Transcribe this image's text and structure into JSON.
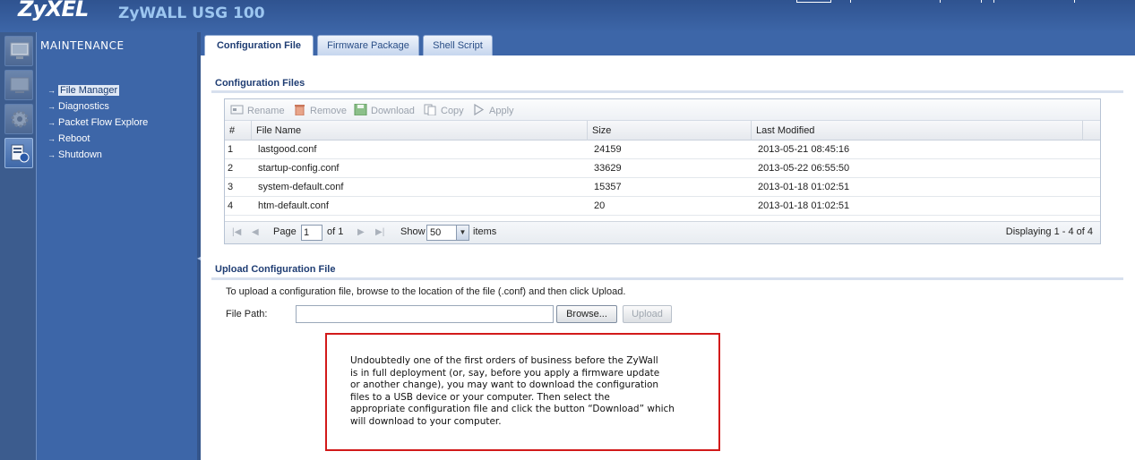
{
  "header": {
    "brand": "ZyXEL",
    "product": "ZyWALL USG 100"
  },
  "menu": {
    "title": "MAINTENANCE",
    "items": [
      {
        "label": "File Manager",
        "selected": true
      },
      {
        "label": "Diagnostics",
        "selected": false
      },
      {
        "label": "Packet Flow Explore",
        "selected": false
      },
      {
        "label": "Reboot",
        "selected": false
      },
      {
        "label": "Shutdown",
        "selected": false
      }
    ]
  },
  "tabs": [
    {
      "label": "Configuration File",
      "active": true
    },
    {
      "label": "Firmware Package",
      "active": false
    },
    {
      "label": "Shell Script",
      "active": false
    }
  ],
  "config_files": {
    "title": "Configuration Files",
    "toolbar": {
      "rename": "Rename",
      "remove": "Remove",
      "download": "Download",
      "copy": "Copy",
      "apply": "Apply"
    },
    "columns": [
      "#",
      "File Name",
      "Size",
      "Last Modified"
    ],
    "rows": [
      {
        "num": "1",
        "name": "lastgood.conf",
        "size": "24159",
        "modified": "2013-05-21 08:45:16"
      },
      {
        "num": "2",
        "name": "startup-config.conf",
        "size": "33629",
        "modified": "2013-05-22 06:55:50"
      },
      {
        "num": "3",
        "name": "system-default.conf",
        "size": "15357",
        "modified": "2013-01-18 01:02:51"
      },
      {
        "num": "4",
        "name": "htm-default.conf",
        "size": "20",
        "modified": "2013-01-18 01:02:51"
      }
    ],
    "pager": {
      "page_label": "Page",
      "page_value": "1",
      "of_label": "of 1",
      "show_label": "Show",
      "show_value": "50",
      "items_label": "items",
      "displaying": "Displaying 1 - 4 of 4"
    }
  },
  "upload": {
    "title": "Upload Configuration File",
    "instructions": "To upload a configuration file, browse to the location of the file (.conf) and then click Upload.",
    "file_path_label": "File Path:",
    "file_path_value": "",
    "browse_label": "Browse...",
    "upload_label": "Upload"
  },
  "annotation": {
    "text": "Undoubtedly one of the first orders of business before the ZyWall\nis in full deployment (or, say, before you apply a firmware update\nor another change), you may want to download the configuration\nfiles to a USB device or your computer.  Then select the\nappropriate configuration file and click the button “Download” which\nwill download to your computer."
  },
  "colors": {
    "header_bg": "#2f5390",
    "menu_bg": "#3d66a8",
    "section_title": "#1f3d73",
    "annotation_border": "#d21a1a"
  }
}
